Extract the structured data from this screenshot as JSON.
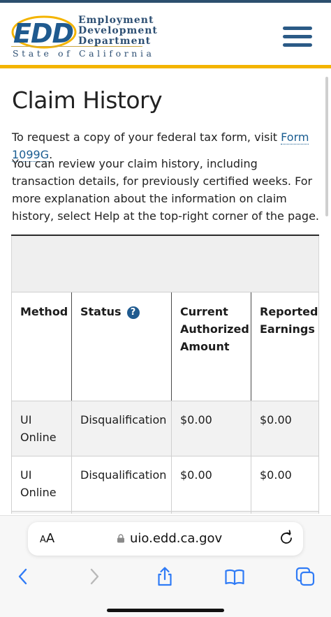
{
  "header": {
    "logo_abbr": "EDD",
    "logo_line1": "Employment",
    "logo_line2": "Development",
    "logo_line3": "Department",
    "logo_state": "State of California",
    "menu_icon": "hamburger-menu-icon",
    "colors": {
      "gold": "#f4b400",
      "blue": "#1f5a8f",
      "topline": "#2c4f6e"
    }
  },
  "page": {
    "title": "Claim History",
    "intro_prefix": "To request a copy of your federal tax form, visit ",
    "intro_link": "Form 1099G",
    "intro_suffix": ".",
    "description": "You can review your claim history, including transaction details, for previously certified weeks. For more explanation about the information on claim history, select Help at the top-right corner of the page."
  },
  "table": {
    "headers": [
      "Method",
      "Status",
      "Current Authorized Amount",
      "Reported Earnings"
    ],
    "help_icon": "question-circle-icon",
    "help_glyph": "?",
    "rows": [
      [
        "UI Online",
        "Disqualification",
        "$0.00",
        "$0.00"
      ],
      [
        "UI Online",
        "Disqualification",
        "$0.00",
        "$0.00"
      ]
    ]
  },
  "browser": {
    "text_size_small": "A",
    "text_size_large": "A",
    "url": "uio.edd.ca.gov",
    "icons": [
      "lock-icon",
      "reload-icon",
      "back-icon",
      "forward-icon",
      "share-icon",
      "bookmarks-icon",
      "tabs-icon"
    ]
  }
}
